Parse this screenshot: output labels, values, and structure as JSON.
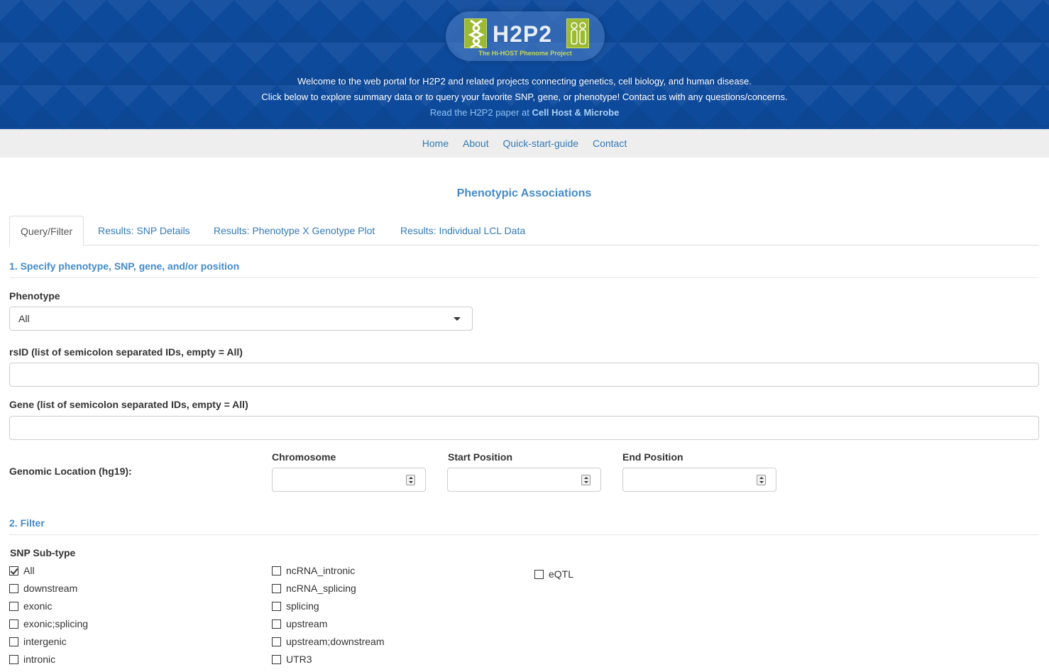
{
  "header": {
    "logo_text": "H2P2",
    "logo_subtitle": "The Hi-HOST Phenome Project",
    "line1": "Welcome to the web portal for H2P2 and related projects connecting genetics, cell biology, and human disease.",
    "line2": "Click below to explore summary data or to query your favorite SNP, gene, or phenotype! Contact us with any questions/concerns.",
    "line3_prefix": "Read the H2P2 paper at ",
    "line3_link": "Cell Host & Microbe"
  },
  "nav": {
    "items": [
      "Home",
      "About",
      "Quick-start-guide",
      "Contact"
    ]
  },
  "page_title": "Phenotypic Associations",
  "tabs": [
    "Query/Filter",
    "Results: SNP Details",
    "Results: Phenotype X Genotype Plot",
    "Results: Individual LCL Data"
  ],
  "section1": {
    "title": "1. Specify phenotype, SNP, gene, and/or position",
    "phenotype_label": "Phenotype",
    "phenotype_value": "All",
    "rsid_label": "rsID (list of semicolon separated IDs, empty = All)",
    "rsid_value": "",
    "gene_label": "Gene (list of semicolon separated IDs, empty = All)",
    "gene_value": "",
    "genomic_label": "Genomic Location (hg19):",
    "chromosome_label": "Chromosome",
    "start_label": "Start Position",
    "end_label": "End Position"
  },
  "section2": {
    "title": "2. Filter",
    "subtype_label": "SNP Sub-type",
    "col1": [
      {
        "label": "All",
        "checked": true
      },
      {
        "label": "downstream",
        "checked": false
      },
      {
        "label": "exonic",
        "checked": false
      },
      {
        "label": "exonic;splicing",
        "checked": false
      },
      {
        "label": "intergenic",
        "checked": false
      },
      {
        "label": "intronic",
        "checked": false
      }
    ],
    "col2": [
      {
        "label": "ncRNA_intronic",
        "checked": false
      },
      {
        "label": "ncRNA_splicing",
        "checked": false
      },
      {
        "label": "splicing",
        "checked": false
      },
      {
        "label": "upstream",
        "checked": false
      },
      {
        "label": "upstream;downstream",
        "checked": false
      },
      {
        "label": "UTR3",
        "checked": false
      }
    ],
    "col3": [
      {
        "label": "eQTL",
        "checked": false
      }
    ]
  },
  "colors": {
    "header_bg": "#0e4a9c",
    "link": "#337ab7",
    "section_title": "#428bca"
  }
}
